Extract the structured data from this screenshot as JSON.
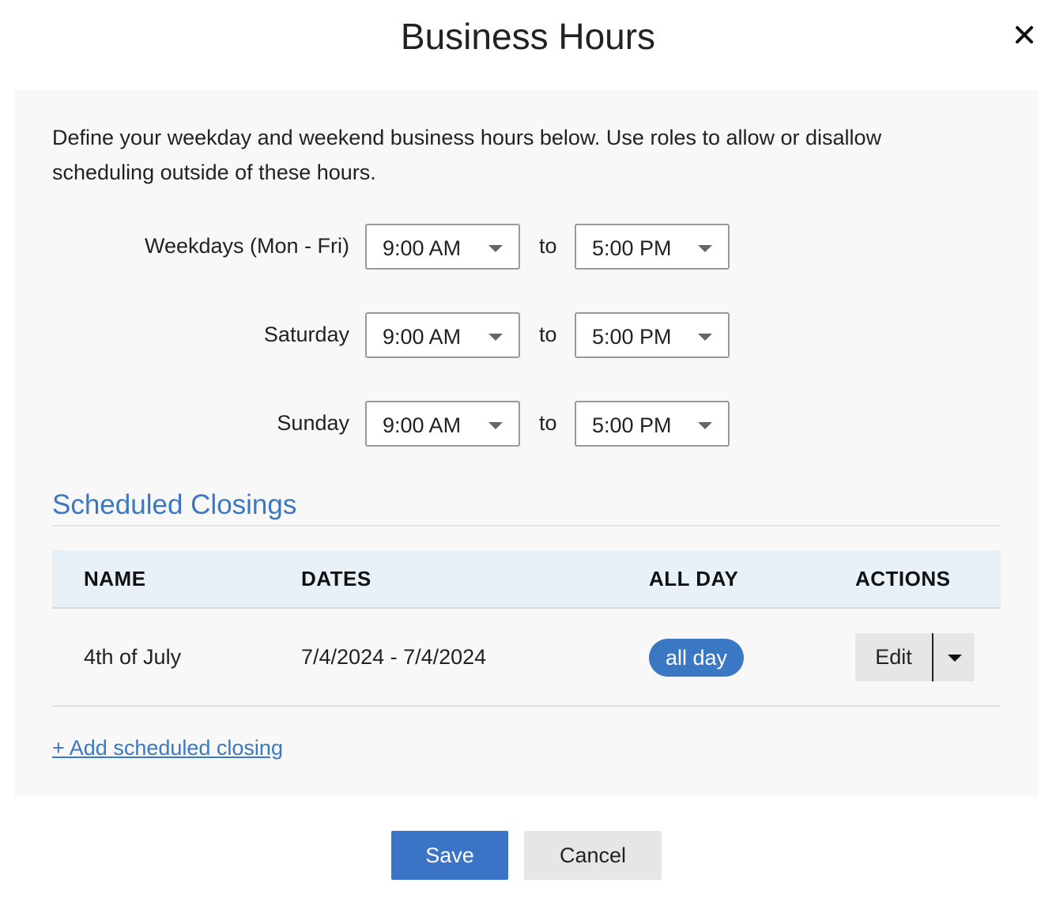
{
  "dialog": {
    "title": "Business Hours",
    "close_icon": "close-icon"
  },
  "intro_text": "Define your weekday and weekend business hours below. Use roles to allow or disallow scheduling outside of these hours.",
  "hours": [
    {
      "label": "Weekdays (Mon - Fri)",
      "start": "9:00 AM",
      "separator": "to",
      "end": "5:00 PM"
    },
    {
      "label": "Saturday",
      "start": "9:00 AM",
      "separator": "to",
      "end": "5:00 PM"
    },
    {
      "label": "Sunday",
      "start": "9:00 AM",
      "separator": "to",
      "end": "5:00 PM"
    }
  ],
  "closings": {
    "heading": "Scheduled Closings",
    "columns": [
      "NAME",
      "DATES",
      "ALL DAY",
      "ACTIONS"
    ],
    "rows": [
      {
        "name": "4th of July",
        "dates": "7/4/2024 - 7/4/2024",
        "all_day": "all day",
        "action": "Edit"
      }
    ],
    "add_link": "+ Add scheduled closing"
  },
  "footer": {
    "save_label": "Save",
    "cancel_label": "Cancel"
  },
  "colors": {
    "accent": "#3b78c4",
    "primary_button": "#3b73c6",
    "panel_bg": "#f8f8f8",
    "table_header_bg": "#e8f0f8",
    "secondary_button": "#e6e6e6"
  }
}
